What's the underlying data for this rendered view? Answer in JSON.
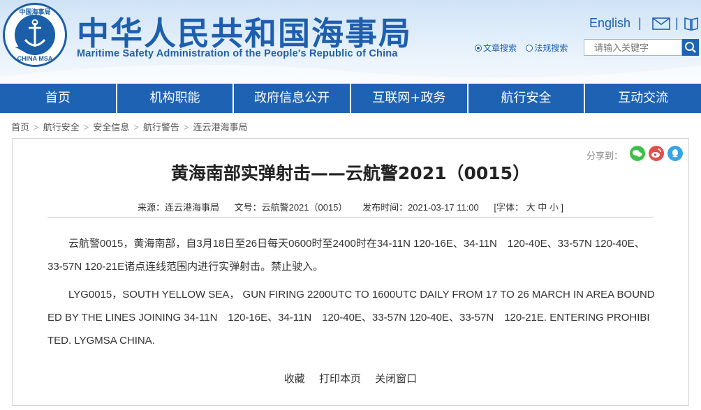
{
  "header": {
    "logo_top_text": "中国海事局",
    "logo_bottom_text": "CHINA MSA",
    "title": "中华人民共和国海事局",
    "subtitle": "Maritime Safety Administration of the People's Republic of China",
    "lang_link": "English",
    "separator": "|",
    "search_options": [
      "文章搜索",
      "法规搜索"
    ],
    "search_placeholder": "请输入关键字"
  },
  "nav": [
    "首页",
    "机构职能",
    "政府信息公开",
    "互联网+政务",
    "航行安全",
    "互动交流"
  ],
  "breadcrumb": [
    "首页",
    "航行安全",
    "安全信息",
    "航行警告",
    "连云港海事局"
  ],
  "share_label": "分享到：",
  "article": {
    "title": "黄海南部实弹射击——云航警2021（0015）",
    "source": "来源：连云港海事局",
    "docno": "文号：云航警2021（0015）",
    "time": "发布时间：2021-03-17 11:00",
    "font_size": "[字体： 大  中  小 ]",
    "para1": "云航警0015，黄海南部，自3月18日至26日每天0600时至2400时在34-11N 120-16E、34-11N　120-40E、33-57N 120-40E、33-57N 120-21E诸点连线范围内进行实弹射击。禁止驶入。",
    "para2": "LYG0015，SOUTH YELLOW SEA， GUN FIRING 2200UTC TO 1600UTC DAILY FROM 17 TO 26 MARCH IN AREA BOUNDED BY THE LINES JOINING 34-11N　120-16E、34-11N　120-40E、33-57N 120-40E、33-57N　120-21E. ENTERING PROHIBITED. LYGMSA CHINA."
  },
  "actions": [
    "收藏",
    "打印本页",
    "关闭窗口"
  ],
  "colors": {
    "brand_blue": "#1e63b3",
    "wechat": "#3fbf4a",
    "weibo": "#e0504d",
    "qq": "#3aa3e8"
  }
}
